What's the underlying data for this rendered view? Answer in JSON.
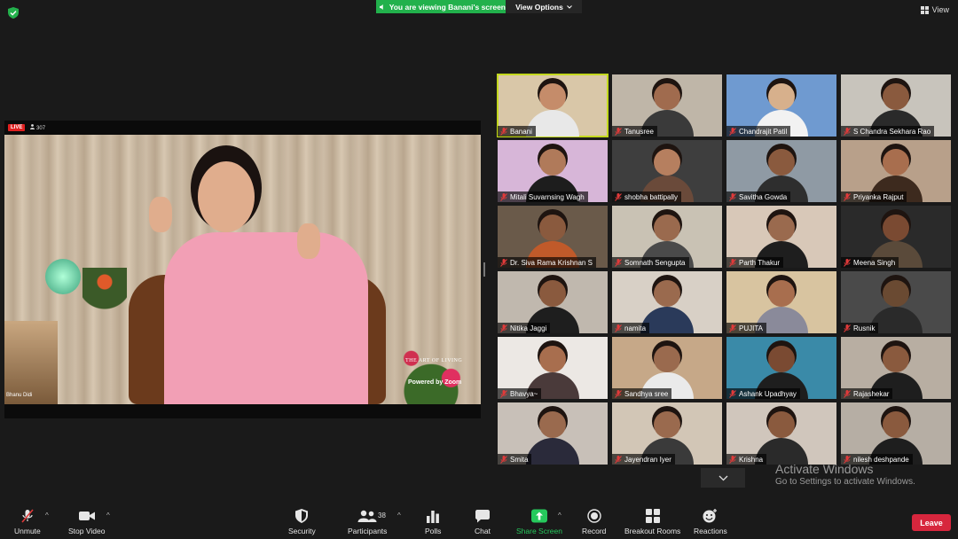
{
  "top_bar": {
    "viewing_banner": "You are viewing Banani's screen",
    "view_options": "View Options",
    "view_button": "View"
  },
  "share": {
    "live_badge": "LIVE",
    "viewer_count": "307",
    "book_caption": "Bhanu Didi",
    "watermark": "THE ART OF LIVING",
    "powered_by": "Powered by Zoom"
  },
  "participants": [
    {
      "name": "Banani",
      "bg": "#d9c7a8",
      "skin": "#c58c6a",
      "shirt": "#e8e8e8",
      "active": true
    },
    {
      "name": "Tanusree",
      "bg": "#bfb6a8",
      "skin": "#a06b4e",
      "shirt": "#3a3a3a"
    },
    {
      "name": "Chandrajit Patil",
      "bg": "#6f9ad0",
      "skin": "#d7b08c",
      "shirt": "#f2f2f2"
    },
    {
      "name": "S Chandra Sekhara Rao",
      "bg": "#c8c4bc",
      "skin": "#8a5a3e",
      "shirt": "#2a2a2a"
    },
    {
      "name": "Mitali Suvarnsing Wagh",
      "bg": "#d7b6d8",
      "skin": "#b07a5a",
      "shirt": "#1d1d1d"
    },
    {
      "name": "shobha battipally",
      "bg": "#3e3e3e",
      "skin": "#b67f5f",
      "shirt": "#6a4a3a"
    },
    {
      "name": "Savitha Gowda",
      "bg": "#8f9aa4",
      "skin": "#8a5a3e",
      "shirt": "#2e2e2e"
    },
    {
      "name": "Priyanka Rajput",
      "bg": "#b8a08a",
      "skin": "#a86e4e",
      "shirt": "#3d2a1e"
    },
    {
      "name": "Dr. Siva Rama Krishnan S",
      "bg": "#6a5a4a",
      "skin": "#8a5a3e",
      "shirt": "#c05a2a"
    },
    {
      "name": "Somnath Sengupta",
      "bg": "#c9c2b4",
      "skin": "#9a6a4e",
      "shirt": "#4a4a4a"
    },
    {
      "name": "Parth Thakur",
      "bg": "#d8c8b8",
      "skin": "#9a6a4e",
      "shirt": "#1e1e1e"
    },
    {
      "name": "Meena Singh",
      "bg": "#2a2a2a",
      "skin": "#7a4a32",
      "shirt": "#5a4a3a"
    },
    {
      "name": "Nitika Jaggi",
      "bg": "#c0b8ae",
      "skin": "#8a5a3e",
      "shirt": "#1e1e1e"
    },
    {
      "name": "namita",
      "bg": "#d8d0c6",
      "skin": "#9a6a4e",
      "shirt": "#2a3a5a"
    },
    {
      "name": "PUJITA",
      "bg": "#d8c4a0",
      "skin": "#a86e4e",
      "shirt": "#8a8a9a"
    },
    {
      "name": "Rusnik",
      "bg": "#4a4a4a",
      "skin": "#6a4a32",
      "shirt": "#2a2a2a"
    },
    {
      "name": "Bhavya~",
      "bg": "#ece8e4",
      "skin": "#a86e4e",
      "shirt": "#4a3a3a"
    },
    {
      "name": "Sandhya sree",
      "bg": "#c6a888",
      "skin": "#9a6a4e",
      "shirt": "#eaeaea"
    },
    {
      "name": "Ashank Upadhyay",
      "bg": "#3a8aa8",
      "skin": "#7a4a32",
      "shirt": "#1e1e1e"
    },
    {
      "name": "Rajashekar",
      "bg": "#b8aea2",
      "skin": "#8a5a3e",
      "shirt": "#1e1e1e"
    },
    {
      "name": "Smita",
      "bg": "#c8c0b8",
      "skin": "#9a6a4e",
      "shirt": "#2a2a3a"
    },
    {
      "name": "Jayendran Iyer",
      "bg": "#d2c6b6",
      "skin": "#9a6a4e",
      "shirt": "#3a3a3a"
    },
    {
      "name": "Krishna",
      "bg": "#d0c6bc",
      "skin": "#8a5a3e",
      "shirt": "#2a2a2a"
    },
    {
      "name": "nilesh deshpande",
      "bg": "#b6aea4",
      "skin": "#8a5a3e",
      "shirt": "#1e1e1e"
    }
  ],
  "activation": {
    "title": "Activate Windows",
    "subtitle": "Go to Settings to activate Windows."
  },
  "toolbar": {
    "unmute": "Unmute",
    "stop_video": "Stop Video",
    "security": "Security",
    "participants": "Participants",
    "participant_count": "38",
    "polls": "Polls",
    "chat": "Chat",
    "share_screen": "Share Screen",
    "record": "Record",
    "breakout_rooms": "Breakout Rooms",
    "reactions": "Reactions",
    "leave": "Leave"
  },
  "colors": {
    "banner_green": "#22b14c",
    "active_speaker": "#c3d81e",
    "leave_red": "#d7263d",
    "mic_off_red": "#e03a3a"
  }
}
